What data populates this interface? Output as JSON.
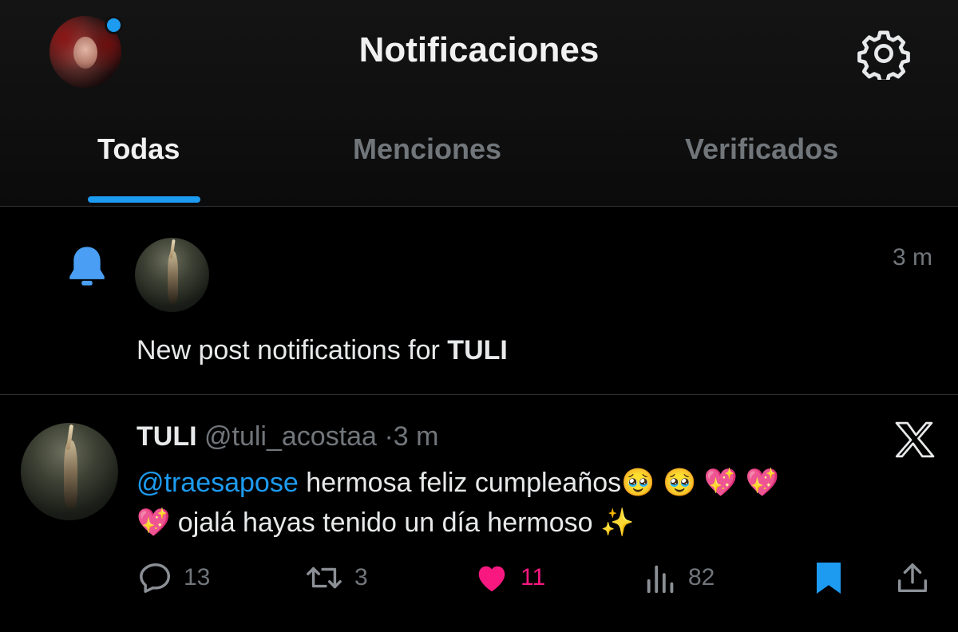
{
  "header": {
    "title": "Notificaciones",
    "tabs": [
      {
        "label": "Todas",
        "active": true
      },
      {
        "label": "Menciones",
        "active": false
      },
      {
        "label": "Verificados",
        "active": false
      }
    ],
    "accent": "#1d9bf0",
    "icons": {
      "settings": "gear-icon",
      "profile": "avatar"
    }
  },
  "notification": {
    "time": "3 m",
    "text_prefix": "New post notifications for ",
    "text_bold": "TULI",
    "icon": "bell-icon"
  },
  "post": {
    "name": "TULI",
    "handle": "@tuli_acostaa",
    "separator": "·",
    "time": "3 m",
    "mention": "@traesapose",
    "text_line1": " hermosa feliz cumpleaños🥹 🥹 💖 💖",
    "text_line2": "💖  ojalá hayas tenido un día hermoso ✨",
    "actions": {
      "replies": "13",
      "reposts": "3",
      "likes": "11",
      "views": "82"
    },
    "like_color": "#f91880",
    "bookmark_color": "#1d9bf0"
  }
}
